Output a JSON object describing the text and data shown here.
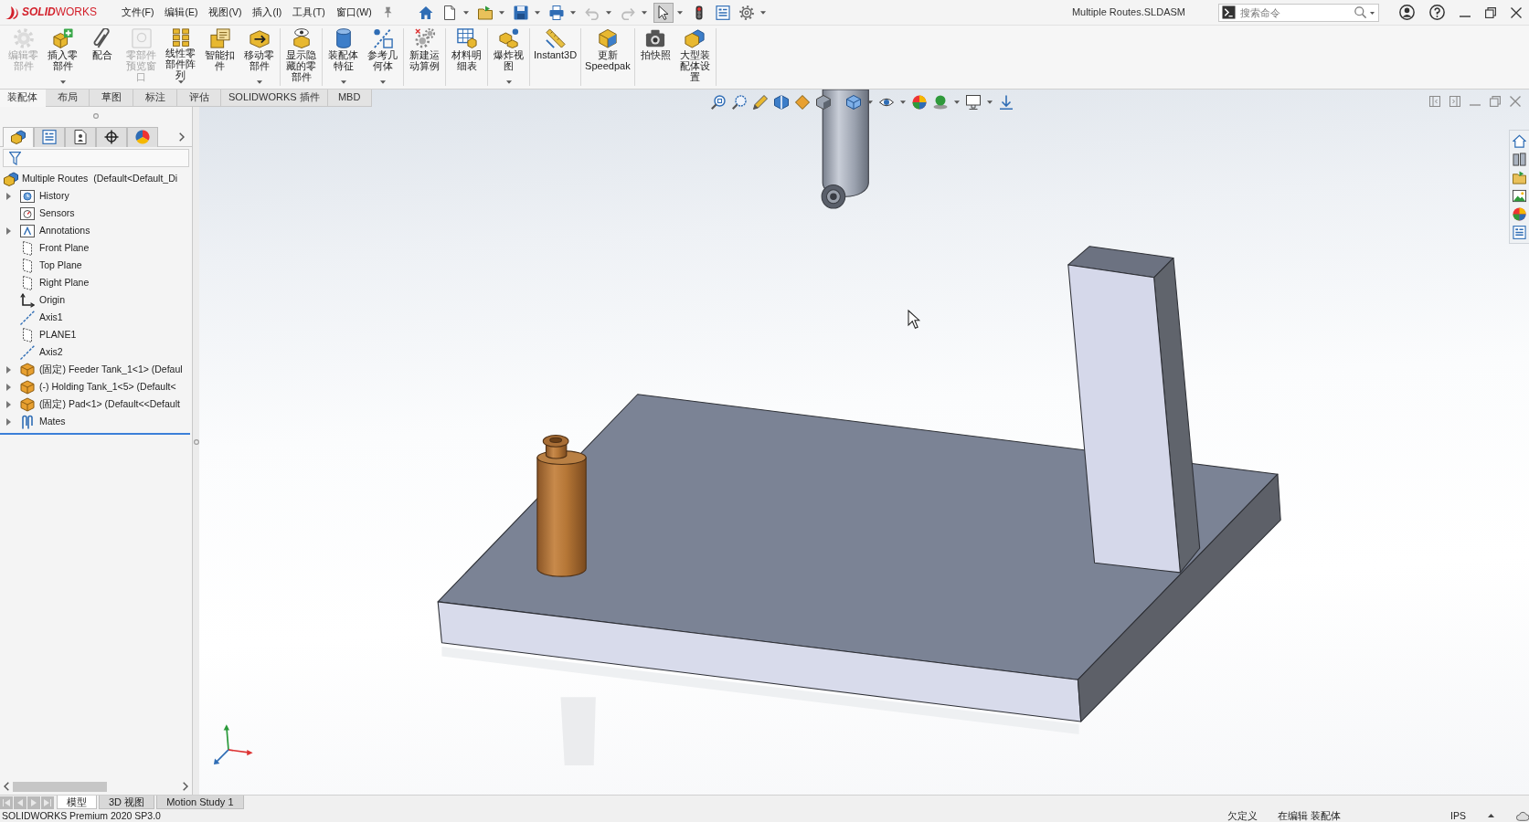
{
  "app": {
    "logo": "**SOLID**WORKS"
  },
  "menu": [
    "文件(F)",
    "编辑(E)",
    "视图(V)",
    "插入(I)",
    "工具(T)",
    "窗口(W)"
  ],
  "quick_access": [
    {
      "kind": "home",
      "dropdown": false,
      "disabled": false,
      "selected": false
    },
    {
      "kind": "new",
      "dropdown": true,
      "disabled": false,
      "selected": false
    },
    {
      "kind": "open",
      "dropdown": true,
      "disabled": false,
      "selected": false
    },
    {
      "kind": "save",
      "dropdown": true,
      "disabled": false,
      "selected": false
    },
    {
      "kind": "print",
      "dropdown": true,
      "disabled": false,
      "selected": false
    },
    {
      "kind": "undo",
      "dropdown": true,
      "disabled": true,
      "selected": false
    },
    {
      "kind": "redo",
      "dropdown": true,
      "disabled": true,
      "selected": false
    },
    {
      "kind": "select",
      "dropdown": true,
      "disabled": false,
      "selected": true
    },
    {
      "kind": "rebuild",
      "dropdown": false,
      "disabled": false,
      "selected": false
    },
    {
      "kind": "file-properties",
      "dropdown": false,
      "disabled": false,
      "selected": false
    },
    {
      "kind": "options",
      "dropdown": true,
      "disabled": false,
      "selected": false
    }
  ],
  "window": {
    "title": "Multiple Routes.SLDASM"
  },
  "search": {
    "placeholder": "搜索命令"
  },
  "ribbon": {
    "groups": [
      {
        "buttons": [
          {
            "label": "编辑零部件",
            "kind": "edit-part",
            "disabled": true,
            "dropdown": false
          },
          {
            "label": "插入零部件",
            "kind": "insert-part",
            "disabled": false,
            "dropdown": true
          },
          {
            "label": "配合",
            "kind": "mate",
            "disabled": false,
            "dropdown": false
          },
          {
            "label": "零部件预览窗口",
            "kind": "preview",
            "disabled": true,
            "dropdown": false
          },
          {
            "label": "线性零部件阵列",
            "kind": "pattern",
            "disabled": false,
            "dropdown": true
          },
          {
            "label": "智能扣件",
            "kind": "fastener",
            "disabled": false,
            "dropdown": false
          },
          {
            "label": "移动零部件",
            "kind": "move",
            "disabled": false,
            "dropdown": true
          }
        ]
      },
      {
        "buttons": [
          {
            "label": "显示隐藏的零部件",
            "kind": "show-hidden",
            "disabled": false,
            "dropdown": false
          }
        ]
      },
      {
        "buttons": [
          {
            "label": "装配体特征",
            "kind": "feature",
            "disabled": false,
            "dropdown": true
          },
          {
            "label": "参考几何体",
            "kind": "reference",
            "disabled": false,
            "dropdown": true
          }
        ]
      },
      {
        "buttons": [
          {
            "label": "新建运动算例",
            "kind": "motion",
            "disabled": false,
            "dropdown": false
          }
        ]
      },
      {
        "buttons": [
          {
            "label": "材料明细表",
            "kind": "bom",
            "disabled": false,
            "dropdown": false
          }
        ]
      },
      {
        "buttons": [
          {
            "label": "爆炸视图",
            "kind": "explode",
            "disabled": false,
            "dropdown": true
          }
        ]
      },
      {
        "buttons": [
          {
            "label": "Instant3D",
            "kind": "instant3d",
            "disabled": false,
            "dropdown": false
          }
        ]
      },
      {
        "buttons": [
          {
            "label": "更新 Speedpak",
            "kind": "speedpak",
            "disabled": false,
            "dropdown": false
          }
        ]
      },
      {
        "buttons": [
          {
            "label": "拍快照",
            "kind": "snapshot",
            "disabled": false,
            "dropdown": false
          },
          {
            "label": "大型装配体设置",
            "kind": "large",
            "disabled": false,
            "dropdown": false
          }
        ]
      }
    ],
    "tabs": [
      {
        "label": "装配体",
        "selected": true
      },
      {
        "label": "布局",
        "selected": false
      },
      {
        "label": "草图",
        "selected": false
      },
      {
        "label": "标注",
        "selected": false
      },
      {
        "label": "评估",
        "selected": false
      },
      {
        "label": "SOLIDWORKS 插件",
        "selected": false
      },
      {
        "label": "MBD",
        "selected": false
      }
    ]
  },
  "feature_manager": {
    "tabs": [
      {
        "kind": "tree",
        "selected": true
      },
      {
        "kind": "properties",
        "selected": false
      },
      {
        "kind": "configurations",
        "selected": false
      },
      {
        "kind": "dimxpert",
        "selected": false
      },
      {
        "kind": "display",
        "selected": false
      }
    ],
    "root": {
      "label": "Multiple Routes  (Default<Default_Di"
    },
    "items": [
      {
        "label": "History",
        "kind": "history",
        "expandable": true
      },
      {
        "label": "Sensors",
        "kind": "sensors",
        "expandable": false
      },
      {
        "label": "Annotations",
        "kind": "annotations",
        "expandable": true
      },
      {
        "label": "Front Plane",
        "kind": "plane",
        "expandable": false
      },
      {
        "label": "Top Plane",
        "kind": "plane",
        "expandable": false
      },
      {
        "label": "Right Plane",
        "kind": "plane",
        "expandable": false
      },
      {
        "label": "Origin",
        "kind": "origin",
        "expandable": false
      },
      {
        "label": "Axis1",
        "kind": "axis",
        "expandable": false
      },
      {
        "label": "PLANE1",
        "kind": "plane",
        "expandable": false
      },
      {
        "label": "Axis2",
        "kind": "axis",
        "expandable": false
      },
      {
        "label": "(固定) Feeder Tank_1<1> (Defaul",
        "kind": "part",
        "expandable": true
      },
      {
        "label": "(-) Holding Tank_1<5> (Default<",
        "kind": "part",
        "expandable": true
      },
      {
        "label": "(固定) Pad<1> (Default<<Default",
        "kind": "part",
        "expandable": true
      },
      {
        "label": "Mates",
        "kind": "mates",
        "expandable": true
      }
    ]
  },
  "bottom_tabs": [
    {
      "label": "模型",
      "selected": true
    },
    {
      "label": "3D 视图",
      "selected": false
    },
    {
      "label": "Motion Study 1",
      "selected": false
    }
  ],
  "status_bar": {
    "product": "SOLIDWORKS Premium 2020 SP3.0",
    "definition": "欠定义",
    "editing": "在编辑 装配体",
    "units": "IPS"
  }
}
